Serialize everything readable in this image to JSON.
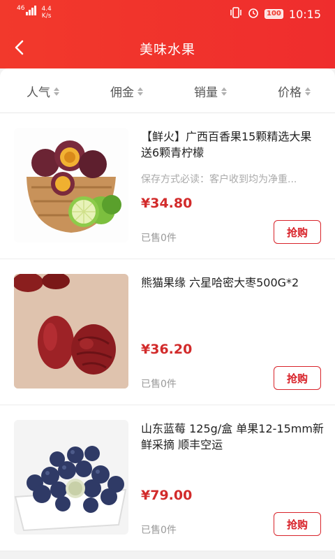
{
  "status_bar": {
    "network": "46",
    "speed_value": "4.4",
    "speed_unit": "K/s",
    "battery": "100",
    "time": "10:15"
  },
  "header": {
    "title": "美味水果",
    "back_icon": "chevron-left-icon"
  },
  "sort_tabs": [
    {
      "label": "人气"
    },
    {
      "label": "佣金"
    },
    {
      "label": "销量"
    },
    {
      "label": "价格"
    }
  ],
  "products": [
    {
      "title": "【鲜火】广西百香果15颗精选大果 送6颗青柠檬",
      "description": "保存方式必读：客户收到均为净重...",
      "price": "¥34.80",
      "sold": "已售0件",
      "buy_label": "抢购",
      "image": "passion-fruit-basket"
    },
    {
      "title": "熊猫果缘 六星哈密大枣500G*2",
      "description": "",
      "price": "¥36.20",
      "sold": "已售0件",
      "buy_label": "抢购",
      "image": "red-dates"
    },
    {
      "title": "山东蓝莓 125g/盒 单果12-15mm新鲜采摘 顺丰空运",
      "description": "",
      "price": "¥79.00",
      "sold": "已售0件",
      "buy_label": "抢购",
      "image": "blueberries-bowl"
    }
  ],
  "colors": {
    "header_red": "#ef2d2d",
    "price_red": "#d22b2b",
    "button_red": "#d8232a"
  }
}
